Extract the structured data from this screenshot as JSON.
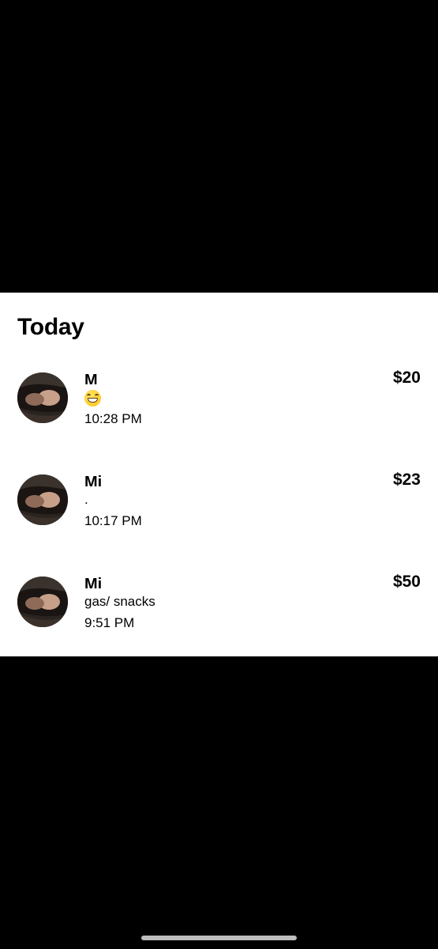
{
  "section": {
    "title": "Today"
  },
  "transactions": [
    {
      "name": "M",
      "amount": "$20",
      "note": "",
      "note_icon": "grinning-face-emoji",
      "time": "10:28 PM"
    },
    {
      "name": "Mi",
      "amount": "$23",
      "note": ".",
      "time": "10:17 PM"
    },
    {
      "name": "Mi",
      "amount": "$50",
      "note": "gas/ snacks",
      "time": "9:51 PM"
    }
  ],
  "colors": {
    "background": "#000000",
    "sheet": "#ffffff",
    "text": "#000000",
    "home_indicator": "#bdbdbd"
  }
}
